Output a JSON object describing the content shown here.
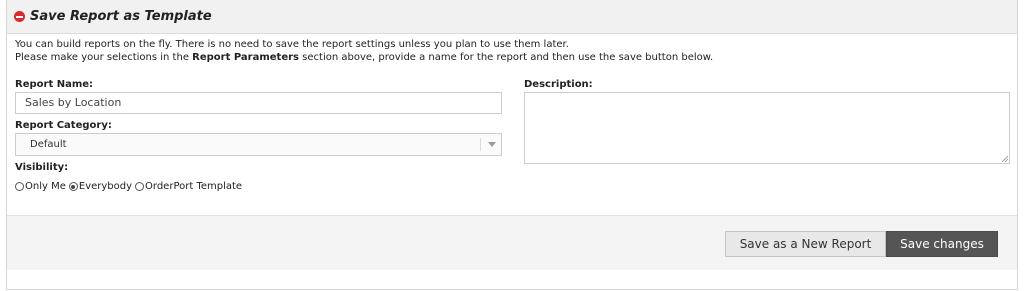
{
  "header": {
    "icon": "minus-circle-icon",
    "icon_color": "#d92b2b",
    "title": "Save Report as Template"
  },
  "intro": {
    "line1": "You can build reports on the fly. There is no need to save the report settings unless you plan to use them later.",
    "line2_before": "Please make your selections in the ",
    "line2_bold": "Report Parameters",
    "line2_after": " section above, provide a name for the report and then use the save button below."
  },
  "form": {
    "report_name_label": "Report Name:",
    "report_name_value": "Sales by Location",
    "report_category_label": "Report Category:",
    "report_category_value": "Default",
    "visibility_label": "Visibility:",
    "visibility_options": [
      {
        "label": "Only Me",
        "checked": false
      },
      {
        "label": "Everybody",
        "checked": true
      },
      {
        "label": "OrderPort Template",
        "checked": false
      }
    ],
    "description_label": "Description:",
    "description_value": ""
  },
  "footer": {
    "save_new_label": "Save as a New Report",
    "save_changes_label": "Save changes",
    "primary_color": "#555555"
  }
}
